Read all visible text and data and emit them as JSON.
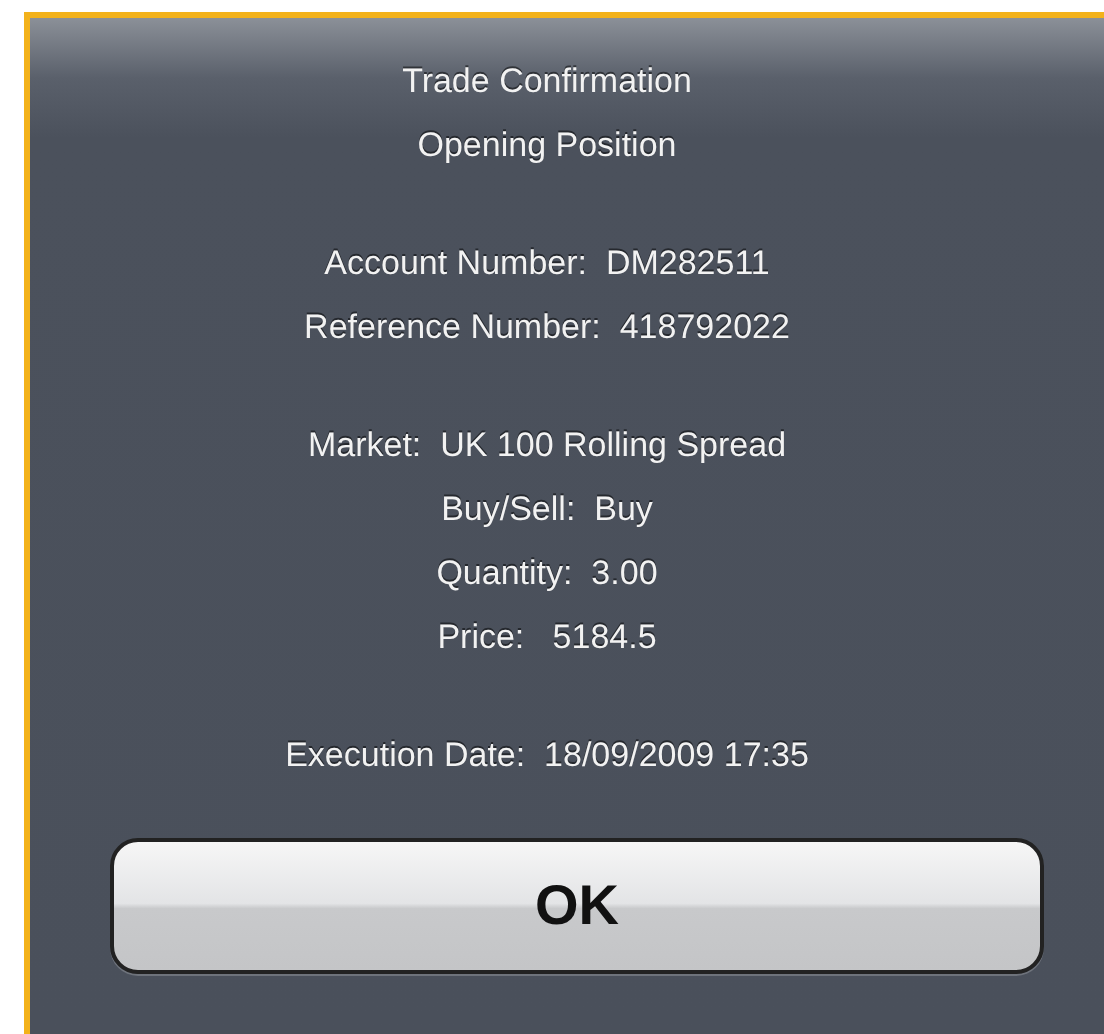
{
  "alert": {
    "title_lines": [
      "Trade Confirmation",
      "Opening Position"
    ],
    "sections": [
      {
        "lines": [
          "Account Number:  DM282511",
          "Reference Number:  418792022"
        ]
      },
      {
        "lines": [
          "Market:  UK 100 Rolling Spread",
          "Buy/Sell:  Buy",
          "Quantity:  3.00",
          "Price:   5184.5"
        ]
      },
      {
        "lines": [
          "Execution Date:  18/09/2009 17:35"
        ]
      }
    ],
    "buttons": [
      "OK"
    ]
  }
}
